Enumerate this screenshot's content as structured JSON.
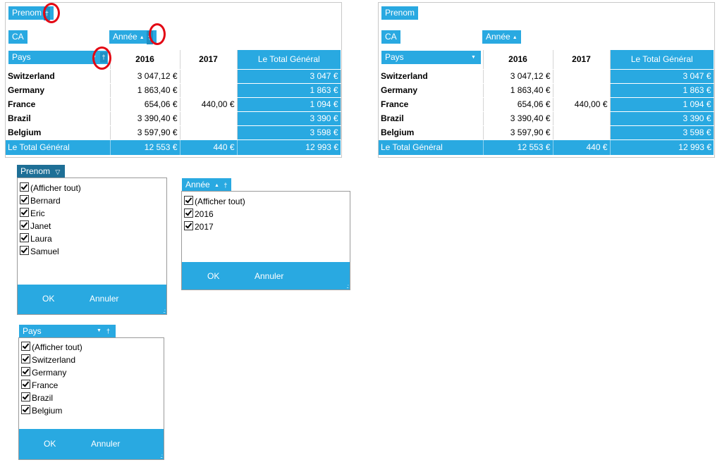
{
  "colors": {
    "accent": "#29a9e1",
    "dark_header": "#1e6f96",
    "circle": "#e30613"
  },
  "pivot": {
    "page_field": "Prenom",
    "data_field": "CA",
    "col_field": "Année",
    "row_field": "Pays",
    "col_headers": [
      "2016",
      "2017",
      "Le Total Général"
    ],
    "rows": [
      {
        "country": "Switzerland",
        "v2016": "3 047,12 €",
        "v2017": "",
        "total": "3 047 €"
      },
      {
        "country": "Germany",
        "v2016": "1 863,40 €",
        "v2017": "",
        "total": "1 863 €"
      },
      {
        "country": "France",
        "v2016": "654,06 €",
        "v2017": "440,00 €",
        "total": "1 094 €"
      },
      {
        "country": "Brazil",
        "v2016": "3 390,40 €",
        "v2017": "",
        "total": "3 390 €"
      },
      {
        "country": "Belgium",
        "v2016": "3 597,90 €",
        "v2017": "",
        "total": "3 598 €"
      }
    ],
    "grand_total": {
      "label": "Le Total Général",
      "v2016": "12 553 €",
      "v2017": "440 €",
      "total": "12 993 €"
    }
  },
  "filters": {
    "prenom": {
      "title": "Prenom",
      "items": [
        "(Afficher tout)",
        "Bernard",
        "Eric",
        "Janet",
        "Laura",
        "Samuel"
      ]
    },
    "annee": {
      "title": "Année",
      "items": [
        "(Afficher tout)",
        "2016",
        "2017"
      ]
    },
    "pays": {
      "title": "Pays",
      "items": [
        "(Afficher tout)",
        "Switzerland",
        "Germany",
        "France",
        "Brazil",
        "Belgium"
      ]
    },
    "ok_label": "OK",
    "cancel_label": "Annuler"
  },
  "icons": {
    "filter": "filter-icon",
    "sort": "sort-asc-icon",
    "grip": "resize-grip-icon"
  }
}
